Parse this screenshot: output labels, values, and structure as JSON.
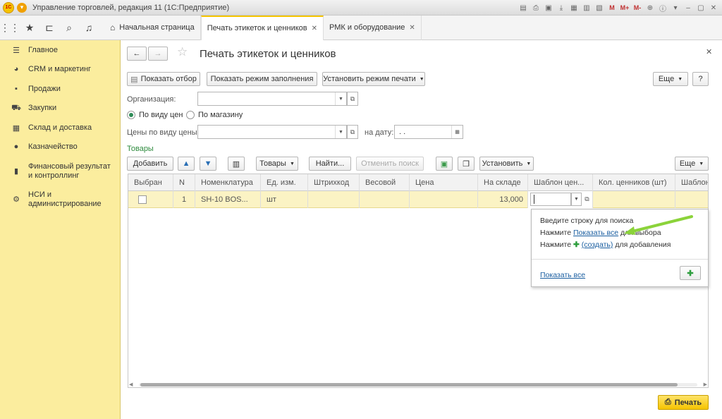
{
  "window": {
    "title": "Управление торговлей, редакция 11  (1С:Предприятие)",
    "logo_text": "1С",
    "toolbar_labels": [
      "M",
      "M+",
      "M-"
    ]
  },
  "tabs": [
    {
      "label": "Начальная страница",
      "closable": false
    },
    {
      "label": "Печать этикеток и ценников",
      "closable": true,
      "active": true
    },
    {
      "label": "РМК и оборудование",
      "closable": true
    }
  ],
  "sidebar": {
    "items": [
      {
        "label": "Главное",
        "icon": "menu-lines-icon"
      },
      {
        "label": "CRM и маркетинг",
        "icon": "pie-chart-icon"
      },
      {
        "label": "Продажи",
        "icon": "bag-icon"
      },
      {
        "label": "Закупки",
        "icon": "cart-icon"
      },
      {
        "label": "Склад и доставка",
        "icon": "grid-icon"
      },
      {
        "label": "Казначейство",
        "icon": "coin-icon"
      },
      {
        "label": "Финансовый результат и контроллинг",
        "icon": "bar-chart-icon"
      },
      {
        "label": "НСИ и администрирование",
        "icon": "gear-icon"
      }
    ]
  },
  "form": {
    "title": "Печать этикеток и ценников",
    "buttons": {
      "show_filter": "Показать отбор",
      "fill_mode": "Показать режим заполнения",
      "print_mode": "Установить режим печати",
      "more": "Еще",
      "help": "?"
    },
    "organization_label": "Организация:",
    "organization_value": "",
    "radio_price_type": "По виду цен",
    "radio_store": "По магазину",
    "prices_label": "Цены по виду цены:",
    "prices_value": "",
    "date_label": "на дату:",
    "date_value": " .  .",
    "goods_section": "Товары"
  },
  "goods_toolbar": {
    "add": "Добавить",
    "goods": "Товары",
    "find": "Найти...",
    "cancel_search": "Отменить поиск",
    "set": "Установить",
    "more": "Еще"
  },
  "table": {
    "columns": [
      "Выбран",
      "N",
      "Номенклатура",
      "Ед. изм.",
      "Штрихкод",
      "Весовой",
      "Цена",
      "На складе",
      "Шаблон цен...",
      "Кол. ценников (шт)",
      "Шаблон"
    ],
    "rows": [
      {
        "selected": false,
        "n": "1",
        "item": "SH-10 BOS...",
        "unit": "шт",
        "barcode": "",
        "weight": "",
        "price": "",
        "stock": "13,000",
        "template": "",
        "count": ""
      }
    ]
  },
  "popup": {
    "line1": "Введите строку для поиска",
    "line2_pre": "Нажмите",
    "line2_link": "Показать все",
    "line2_post": "для выбора",
    "line3_pre": "Нажмите",
    "line3_link": "(создать)",
    "line3_post": "для добавления",
    "show_all": "Показать все"
  },
  "print_button": "Печать",
  "colors": {
    "accent": "#f5c400",
    "sidebar": "#fbed9e",
    "row_selected": "#fbf3c4",
    "link": "#1a5ea0",
    "plus": "#2e9e3e",
    "annotation_arrow": "#8bd33a"
  }
}
